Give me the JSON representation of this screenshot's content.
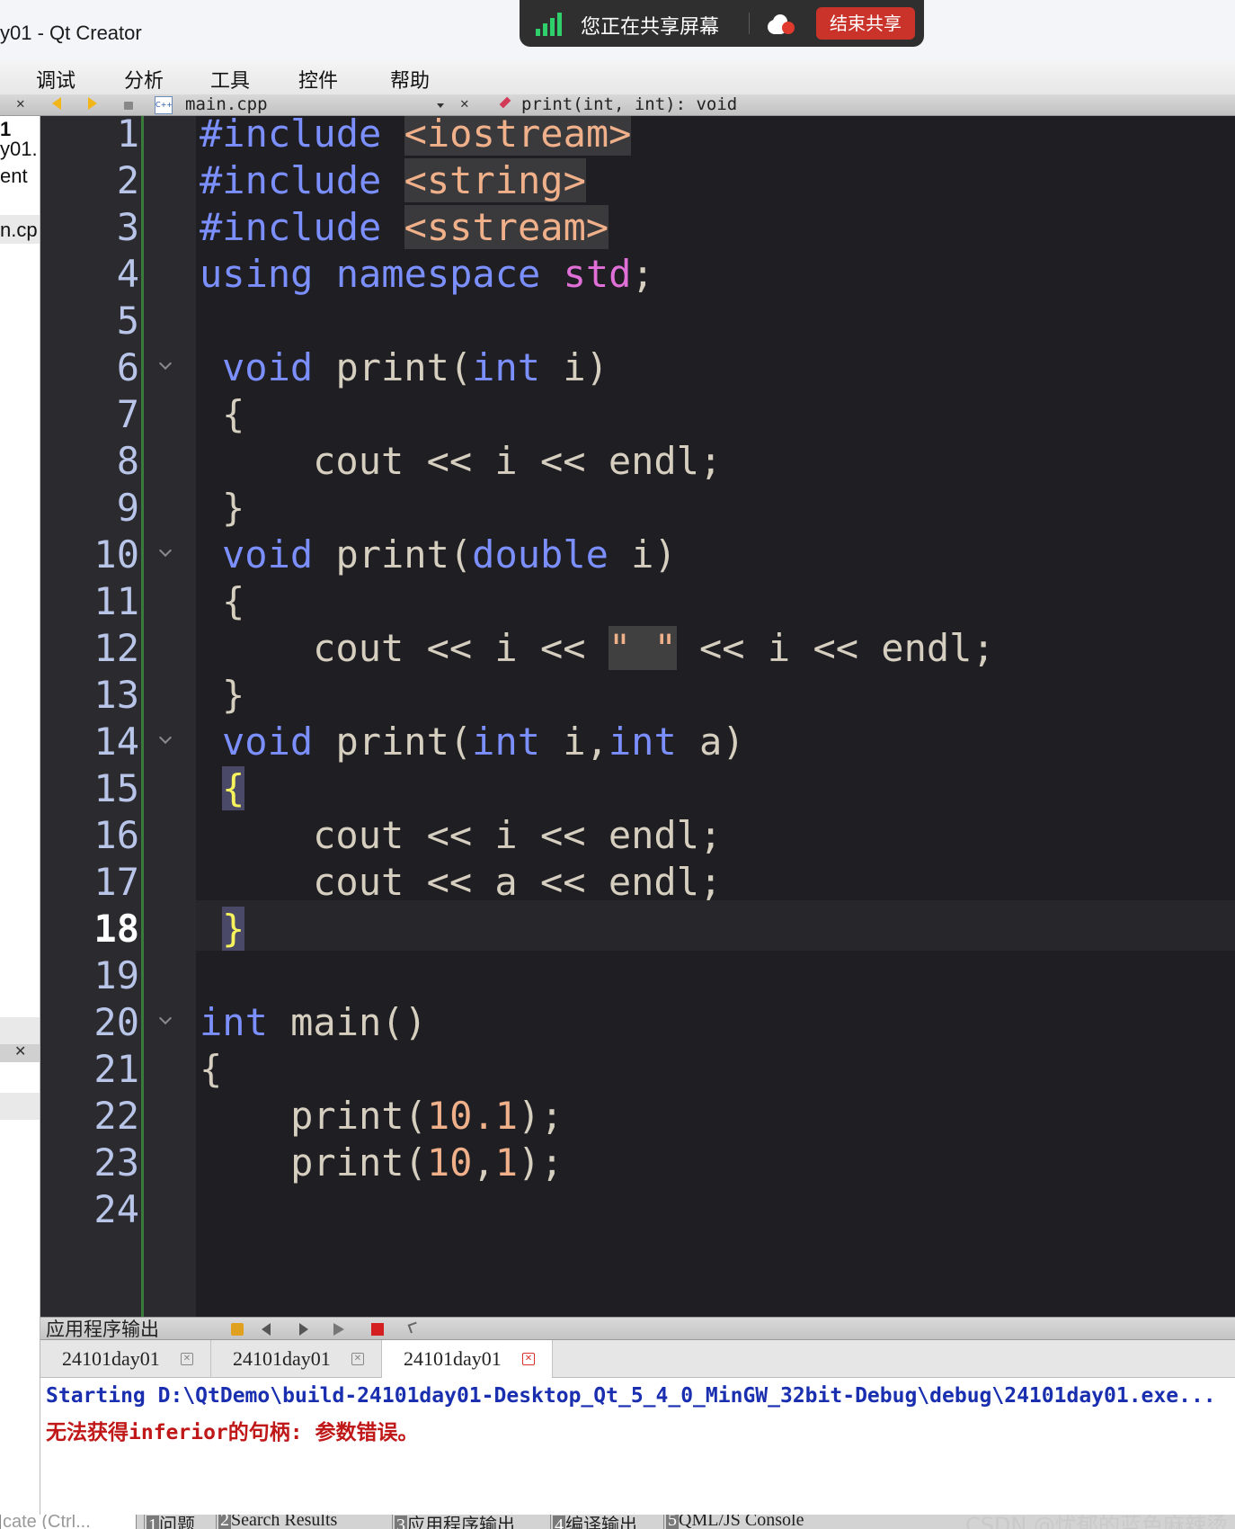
{
  "window": {
    "title": "y01 - Qt Creator"
  },
  "share_bar": {
    "status": "您正在共享屏幕",
    "stop_label": "结束共享"
  },
  "menu": [
    "调试",
    "分析",
    "工具",
    "控件",
    "帮助"
  ],
  "editor_toolbar": {
    "file": "main.cpp",
    "function": "print(int, int): void"
  },
  "sidebar": {
    "lines": [
      "1",
      "y01.",
      "ent",
      "n.cp"
    ]
  },
  "editor": {
    "current_line": 18,
    "lines": [
      "1",
      "2",
      "3",
      "4",
      "5",
      "6",
      "7",
      "8",
      "9",
      "10",
      "11",
      "12",
      "13",
      "14",
      "15",
      "16",
      "17",
      "18",
      "19",
      "20",
      "21",
      "22",
      "23",
      "24"
    ]
  },
  "output": {
    "header": "应用程序输出",
    "tabs": [
      "24101day01",
      "24101day01",
      "24101day01"
    ],
    "active_tab": 2,
    "line1": "Starting D:\\QtDemo\\build-24101day01-Desktop_Qt_5_4_0_MinGW_32bit-Debug\\debug\\24101day01.exe...",
    "line2": "无法获得inferior的句柄: 参数错误。"
  },
  "statusbar": {
    "locator_placeholder": "cate (Ctrl...",
    "items": [
      {
        "num": "1",
        "label": "问题"
      },
      {
        "num": "2",
        "label": "Search Results"
      },
      {
        "num": "3",
        "label": "应用程序输出"
      },
      {
        "num": "4",
        "label": "编译输出"
      },
      {
        "num": "5",
        "label": "QML/JS Console"
      }
    ],
    "watermark": "CSDN @忧郁的蓝色麻辣烫"
  }
}
